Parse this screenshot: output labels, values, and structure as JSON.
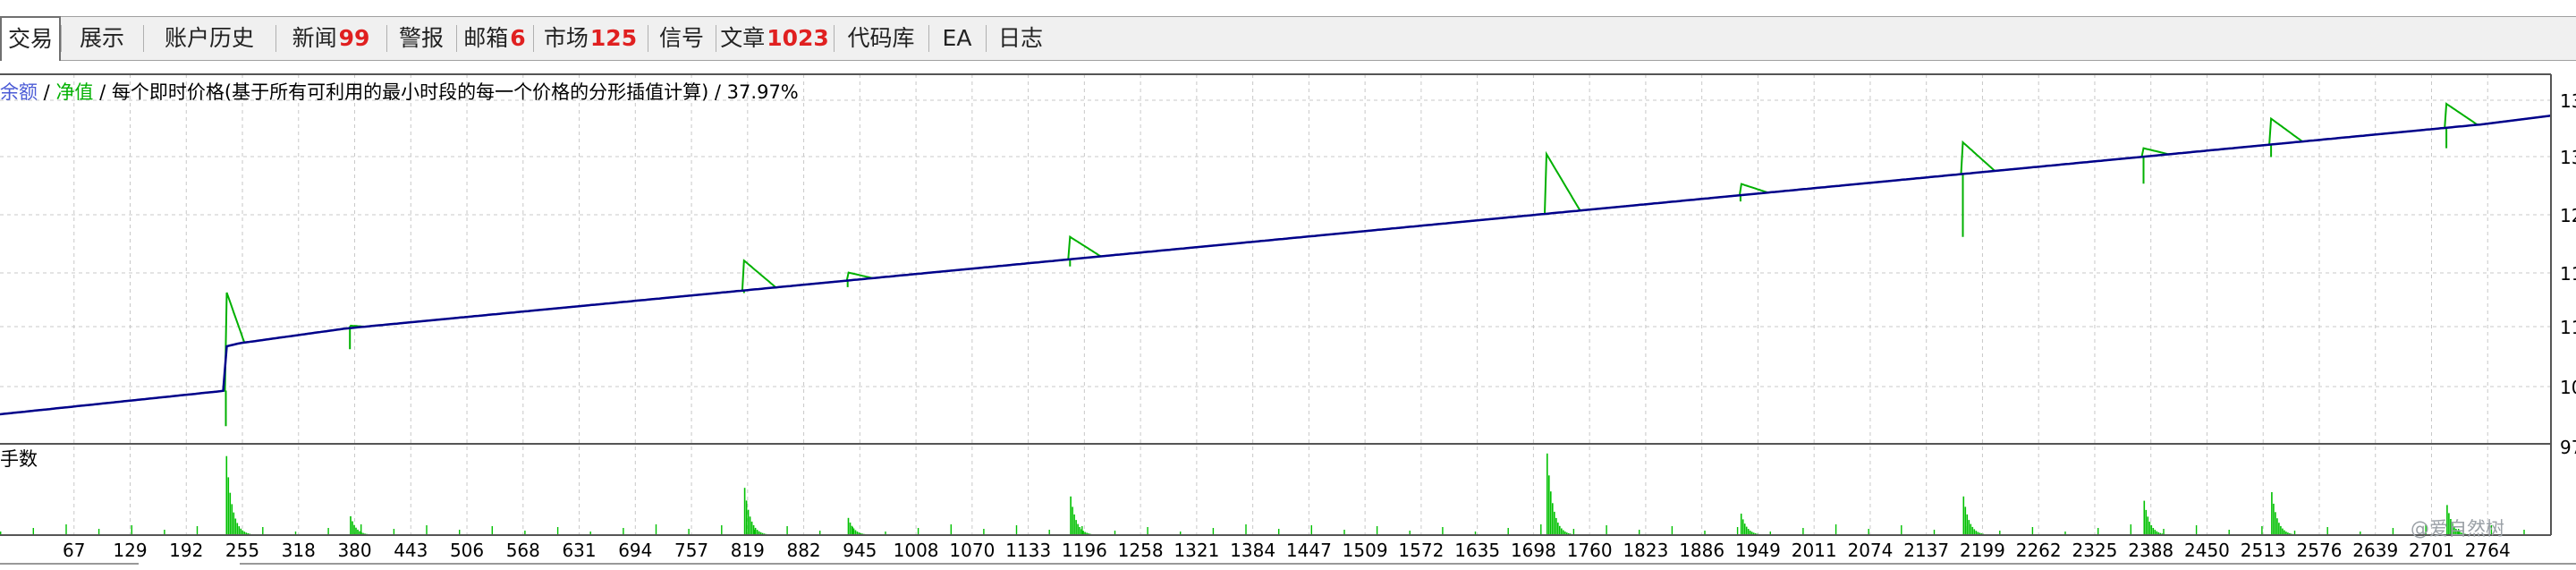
{
  "tabs": [
    {
      "label": "交易",
      "badge": "",
      "active": true
    },
    {
      "label": "展示",
      "badge": ""
    },
    {
      "label": "账户历史",
      "badge": ""
    },
    {
      "label": "新闻",
      "badge": "99"
    },
    {
      "label": "警报",
      "badge": ""
    },
    {
      "label": "邮箱",
      "badge": "6"
    },
    {
      "label": "市场",
      "badge": "125"
    },
    {
      "label": "信号",
      "badge": ""
    },
    {
      "label": "文章",
      "badge": "1023"
    },
    {
      "label": "代码库",
      "badge": ""
    },
    {
      "label": "EA",
      "badge": ""
    },
    {
      "label": "日志",
      "badge": ""
    }
  ],
  "legend": {
    "balance": "余额",
    "sep1": " / ",
    "equity": "净值",
    "sep2": " / ",
    "model": "每个即时价格(基于所有可利用的最小时段的每一个价格的分形插值计算) / 37.97%"
  },
  "lower_panel_label": "手数",
  "watermark": "@爱自然树",
  "colors": {
    "balance": "#00008b",
    "equity": "#00b000",
    "volume": "#00c000",
    "grid": "#c8c8c8"
  },
  "chart_data": {
    "type": "line",
    "x_ticks": [
      "67",
      "129",
      "192",
      "255",
      "318",
      "380",
      "443",
      "506",
      "568",
      "631",
      "694",
      "757",
      "819",
      "882",
      "945",
      "1008",
      "1070",
      "1133",
      "1196",
      "1258",
      "1321",
      "1384",
      "1447",
      "1509",
      "1572",
      "1635",
      "1698",
      "1760",
      "1823",
      "1886",
      "1949",
      "2011",
      "2074",
      "2137",
      "2199",
      "2262",
      "2325",
      "2388",
      "2450",
      "2513",
      "2576",
      "2639",
      "2701",
      "2764"
    ],
    "y_ticks": [
      "13",
      "13",
      "12",
      "11",
      "11",
      "10",
      "97"
    ],
    "series": [
      {
        "name": "余额",
        "points": [
          [
            0,
            100
          ],
          [
            255,
            108
          ],
          [
            256,
            123
          ],
          [
            270,
            124
          ],
          [
            390,
            129
          ],
          [
            2800,
            198
          ],
          [
            2880,
            201
          ]
        ]
      }
    ],
    "spikes": [
      {
        "x": 255,
        "equity_peak": 142,
        "equity_dip": 96,
        "volume": 0.92
      },
      {
        "x": 395,
        "equity_peak": 130,
        "equity_dip": 122,
        "volume": 0.22
      },
      {
        "x": 840,
        "equity_peak": 152,
        "equity_dip": 141,
        "volume": 0.55
      },
      {
        "x": 957,
        "equity_peak": 148,
        "equity_dip": 143,
        "volume": 0.2
      },
      {
        "x": 1208,
        "equity_peak": 160,
        "equity_dip": 150,
        "volume": 0.45
      },
      {
        "x": 1746,
        "equity_peak": 188,
        "equity_dip": 168,
        "volume": 0.95
      },
      {
        "x": 1965,
        "equity_peak": 178,
        "equity_dip": 172,
        "volume": 0.25
      },
      {
        "x": 2216,
        "equity_peak": 192,
        "equity_dip": 160,
        "volume": 0.45
      },
      {
        "x": 2420,
        "equity_peak": 190,
        "equity_dip": 178,
        "volume": 0.4
      },
      {
        "x": 2564,
        "equity_peak": 200,
        "equity_dip": 187,
        "volume": 0.5
      },
      {
        "x": 2762,
        "equity_peak": 205,
        "equity_dip": 190,
        "volume": 0.35
      }
    ]
  }
}
